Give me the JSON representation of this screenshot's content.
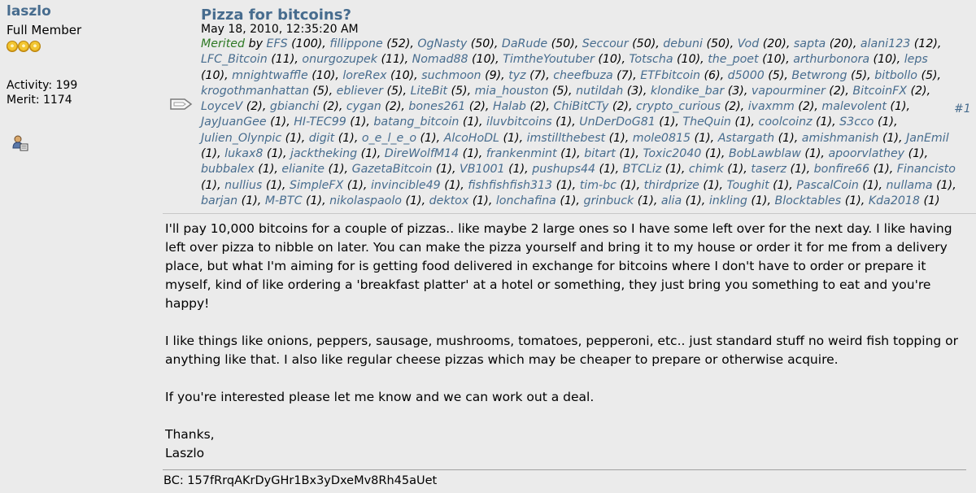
{
  "poster": {
    "username": "laszlo",
    "rank": "Full Member",
    "stars_count": 3,
    "activity": "Activity: 199",
    "merit": "Merit: 1174",
    "icons": [
      "star-icon",
      "profile-icon"
    ]
  },
  "post": {
    "icon": "message-icon",
    "title": "Pizza for bitcoins?",
    "date": "May 18, 2010, 12:35:20 AM",
    "number": "#1",
    "merited_label": "Merited",
    "merited_by": "by",
    "merits": [
      {
        "user": "EFS",
        "count": "(100)"
      },
      {
        "user": "fillippone",
        "count": "(52)"
      },
      {
        "user": "OgNasty",
        "count": "(50)"
      },
      {
        "user": "DaRude",
        "count": "(50)"
      },
      {
        "user": "Seccour",
        "count": "(50)"
      },
      {
        "user": "debuni",
        "count": "(50)"
      },
      {
        "user": "Vod",
        "count": "(20)"
      },
      {
        "user": "sapta",
        "count": "(20)"
      },
      {
        "user": "alani123",
        "count": "(12)"
      },
      {
        "user": "LFC_Bitcoin",
        "count": "(11)"
      },
      {
        "user": "onurgozupek",
        "count": "(11)"
      },
      {
        "user": "Nomad88",
        "count": "(10)"
      },
      {
        "user": "TimtheYoutuber",
        "count": "(10)"
      },
      {
        "user": "Totscha",
        "count": "(10)"
      },
      {
        "user": "the_poet",
        "count": "(10)"
      },
      {
        "user": "arthurbonora",
        "count": "(10)"
      },
      {
        "user": "leps",
        "count": "(10)"
      },
      {
        "user": "mnightwaffle",
        "count": "(10)"
      },
      {
        "user": "loreRex",
        "count": "(10)"
      },
      {
        "user": "suchmoon",
        "count": "(9)"
      },
      {
        "user": "tyz",
        "count": "(7)"
      },
      {
        "user": "cheefbuza",
        "count": "(7)"
      },
      {
        "user": "ETFbitcoin",
        "count": "(6)"
      },
      {
        "user": "d5000",
        "count": "(5)"
      },
      {
        "user": "Betwrong",
        "count": "(5)"
      },
      {
        "user": "bitbollo",
        "count": "(5)"
      },
      {
        "user": "krogothmanhattan",
        "count": "(5)"
      },
      {
        "user": "ebliever",
        "count": "(5)"
      },
      {
        "user": "LiteBit",
        "count": "(5)"
      },
      {
        "user": "mia_houston",
        "count": "(5)"
      },
      {
        "user": "nutildah",
        "count": "(3)"
      },
      {
        "user": "klondike_bar",
        "count": "(3)"
      },
      {
        "user": "vapourminer",
        "count": "(2)"
      },
      {
        "user": "BitcoinFX",
        "count": "(2)"
      },
      {
        "user": "LoyceV",
        "count": "(2)"
      },
      {
        "user": "gbianchi",
        "count": "(2)"
      },
      {
        "user": "cygan",
        "count": "(2)"
      },
      {
        "user": "bones261",
        "count": "(2)"
      },
      {
        "user": "Halab",
        "count": "(2)"
      },
      {
        "user": "ChiBitCTy",
        "count": "(2)"
      },
      {
        "user": "crypto_curious",
        "count": "(2)"
      },
      {
        "user": "ivaxmm",
        "count": "(2)"
      },
      {
        "user": "malevolent",
        "count": "(1)"
      },
      {
        "user": "JayJuanGee",
        "count": "(1)"
      },
      {
        "user": "HI-TEC99",
        "count": "(1)"
      },
      {
        "user": "batang_bitcoin",
        "count": "(1)"
      },
      {
        "user": "iluvbitcoins",
        "count": "(1)"
      },
      {
        "user": "UnDerDoG81",
        "count": "(1)"
      },
      {
        "user": "TheQuin",
        "count": "(1)"
      },
      {
        "user": "coolcoinz",
        "count": "(1)"
      },
      {
        "user": "S3cco",
        "count": "(1)"
      },
      {
        "user": "Julien_Olynpic",
        "count": "(1)"
      },
      {
        "user": "digit",
        "count": "(1)"
      },
      {
        "user": "o_e_l_e_o",
        "count": "(1)"
      },
      {
        "user": "AlcoHoDL",
        "count": "(1)"
      },
      {
        "user": "imstillthebest",
        "count": "(1)"
      },
      {
        "user": "mole0815",
        "count": "(1)"
      },
      {
        "user": "Astargath",
        "count": "(1)"
      },
      {
        "user": "amishmanish",
        "count": "(1)"
      },
      {
        "user": "JanEmil",
        "count": "(1)"
      },
      {
        "user": "lukax8",
        "count": "(1)"
      },
      {
        "user": "jacktheking",
        "count": "(1)"
      },
      {
        "user": "DireWolfM14",
        "count": "(1)"
      },
      {
        "user": "frankenmint",
        "count": "(1)"
      },
      {
        "user": "bitart",
        "count": "(1)"
      },
      {
        "user": "Toxic2040",
        "count": "(1)"
      },
      {
        "user": "BobLawblaw",
        "count": "(1)"
      },
      {
        "user": "apoorvlathey",
        "count": "(1)"
      },
      {
        "user": "bubbalex",
        "count": "(1)"
      },
      {
        "user": "elianite",
        "count": "(1)"
      },
      {
        "user": "GazetaBitcoin",
        "count": "(1)"
      },
      {
        "user": "VB1001",
        "count": "(1)"
      },
      {
        "user": "pushups44",
        "count": "(1)"
      },
      {
        "user": "BTCLiz",
        "count": "(1)"
      },
      {
        "user": "chimk",
        "count": "(1)"
      },
      {
        "user": "taserz",
        "count": "(1)"
      },
      {
        "user": "bonfire66",
        "count": "(1)"
      },
      {
        "user": "Financisto",
        "count": "(1)"
      },
      {
        "user": "nullius",
        "count": "(1)"
      },
      {
        "user": "SimpleFX",
        "count": "(1)"
      },
      {
        "user": "invincible49",
        "count": "(1)"
      },
      {
        "user": "fishfishfish313",
        "count": "(1)"
      },
      {
        "user": "tim-bc",
        "count": "(1)"
      },
      {
        "user": "thirdprize",
        "count": "(1)"
      },
      {
        "user": "Toughit",
        "count": "(1)"
      },
      {
        "user": "PascalCoin",
        "count": "(1)"
      },
      {
        "user": "nullama",
        "count": "(1)"
      },
      {
        "user": "barjan",
        "count": "(1)"
      },
      {
        "user": "M-BTC",
        "count": "(1)"
      },
      {
        "user": "nikolaspaolo",
        "count": "(1)"
      },
      {
        "user": "dektox",
        "count": "(1)"
      },
      {
        "user": "lonchafina",
        "count": "(1)"
      },
      {
        "user": "grinbuck",
        "count": "(1)"
      },
      {
        "user": "alia",
        "count": "(1)"
      },
      {
        "user": "inkling",
        "count": "(1)"
      },
      {
        "user": "Blocktables",
        "count": "(1)"
      },
      {
        "user": "Kda2018",
        "count": "(1)"
      }
    ],
    "body": [
      "I'll pay 10,000 bitcoins for a couple of pizzas.. like maybe 2 large ones so I have some left over for the next day.  I like having left over pizza to nibble on later.  You can make the pizza yourself and bring it to my house or order it for me from a delivery place, but what I'm aiming for is getting food delivered in exchange for bitcoins where I don't have to order or prepare it myself, kind of like ordering a 'breakfast platter' at a hotel or something, they just bring you something to eat and you're happy!",
      "I like things like onions, peppers, sausage, mushrooms, tomatoes, pepperoni, etc.. just standard stuff no weird fish topping or anything like that.  I also like regular cheese pizzas which may be cheaper to prepare or otherwise acquire.",
      "If you're interested please let me know and we can work out a deal.",
      "Thanks,\nLaszlo"
    ],
    "signature": "BC: 157fRrqAKrDyGHr1Bx3yDxeMv8Rh45aUet"
  }
}
